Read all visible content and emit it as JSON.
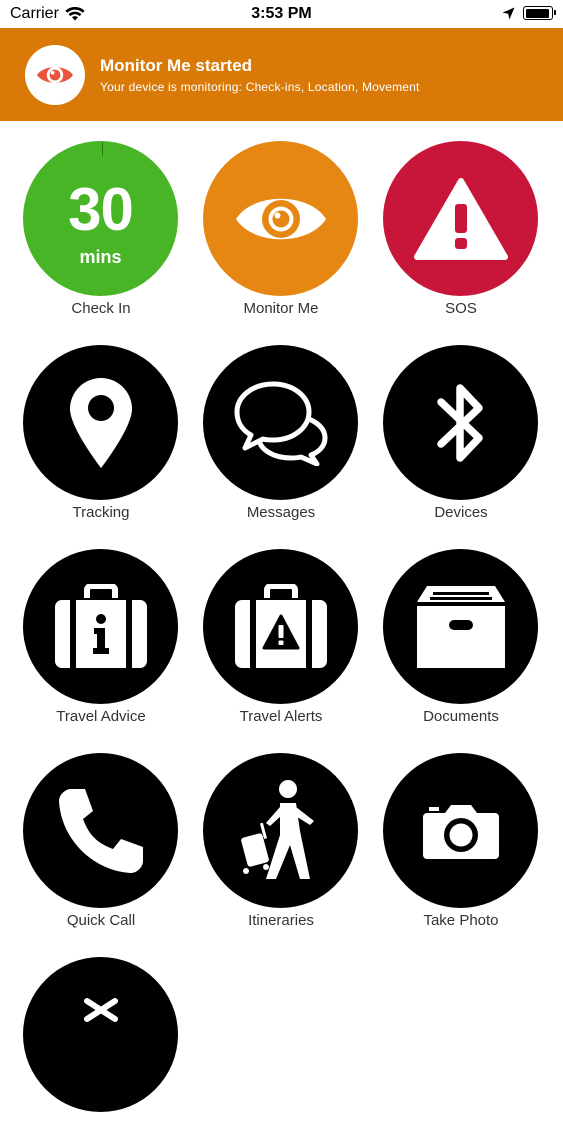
{
  "status_bar": {
    "carrier": "Carrier",
    "time": "3:53 PM",
    "battery_level": 0.95
  },
  "banner": {
    "title": "Monitor Me started",
    "subtitle": "Your device is monitoring: Check-ins, Location, Movement",
    "icon": "eye-icon",
    "background": "#d97a08"
  },
  "tiles": [
    {
      "label": "Check In",
      "icon": "countdown",
      "count": "30",
      "unit": "mins",
      "color": "#47b526"
    },
    {
      "label": "Monitor Me",
      "icon": "eye-icon",
      "color": "#e58712"
    },
    {
      "label": "SOS",
      "icon": "warning-icon",
      "color": "#c8153a"
    },
    {
      "label": "Tracking",
      "icon": "location-pin-icon",
      "color": "#000000"
    },
    {
      "label": "Messages",
      "icon": "chat-bubbles-icon",
      "color": "#000000"
    },
    {
      "label": "Devices",
      "icon": "bluetooth-icon",
      "color": "#000000"
    },
    {
      "label": "Travel Advice",
      "icon": "suitcase-info-icon",
      "color": "#000000"
    },
    {
      "label": "Travel Alerts",
      "icon": "suitcase-alert-icon",
      "color": "#000000"
    },
    {
      "label": "Documents",
      "icon": "archive-box-icon",
      "color": "#000000"
    },
    {
      "label": "Quick Call",
      "icon": "phone-icon",
      "color": "#000000"
    },
    {
      "label": "Itineraries",
      "icon": "traveler-icon",
      "color": "#000000"
    },
    {
      "label": "Take Photo",
      "icon": "camera-icon",
      "color": "#000000"
    },
    {
      "label": "",
      "icon": "partial-icon",
      "color": "#000000"
    }
  ]
}
